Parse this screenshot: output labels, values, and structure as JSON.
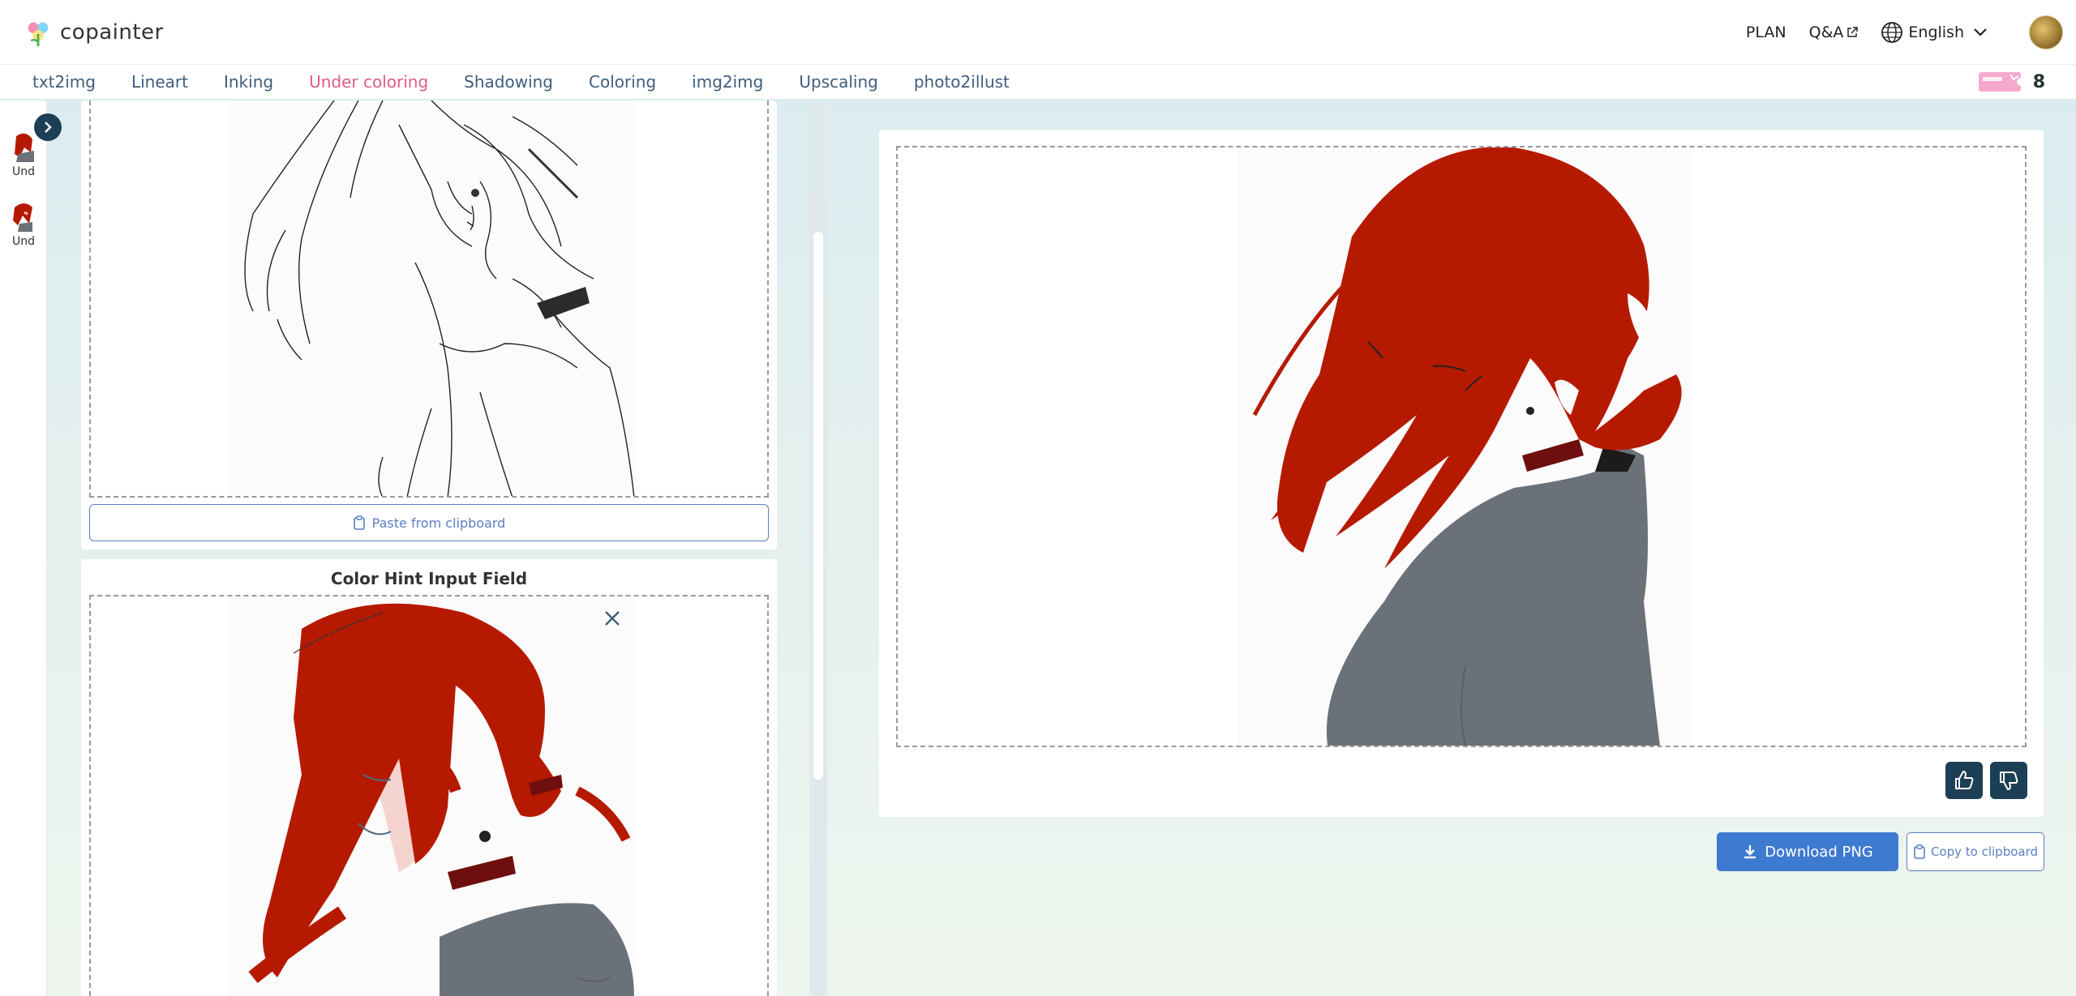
{
  "app": {
    "logo_text": "copainter"
  },
  "header": {
    "plan_label": "PLAN",
    "qa_label": "Q&A",
    "language_label": "English"
  },
  "tabs": [
    {
      "label": "txt2img"
    },
    {
      "label": "Lineart"
    },
    {
      "label": "Inking"
    },
    {
      "label": "Under coloring",
      "active": true
    },
    {
      "label": "Shadowing"
    },
    {
      "label": "Coloring"
    },
    {
      "label": "img2img"
    },
    {
      "label": "Upscaling"
    },
    {
      "label": "photo2illust"
    }
  ],
  "credits": {
    "count": "8"
  },
  "history": [
    {
      "label": "Und"
    },
    {
      "label": "Und"
    }
  ],
  "left": {
    "paste_label": "Paste from clipboard",
    "hint_title": "Color Hint Input Field"
  },
  "result": {
    "download_label": "Download PNG",
    "copy_label": "Copy to clipboard"
  },
  "colors": {
    "accent": "#3f7ad1",
    "tab_active": "#e05a8a",
    "tab_default": "#3f5d7c",
    "dark_button": "#1d3f55",
    "hair_red": "#b51a00",
    "jacket_gray": "#6b7178"
  }
}
